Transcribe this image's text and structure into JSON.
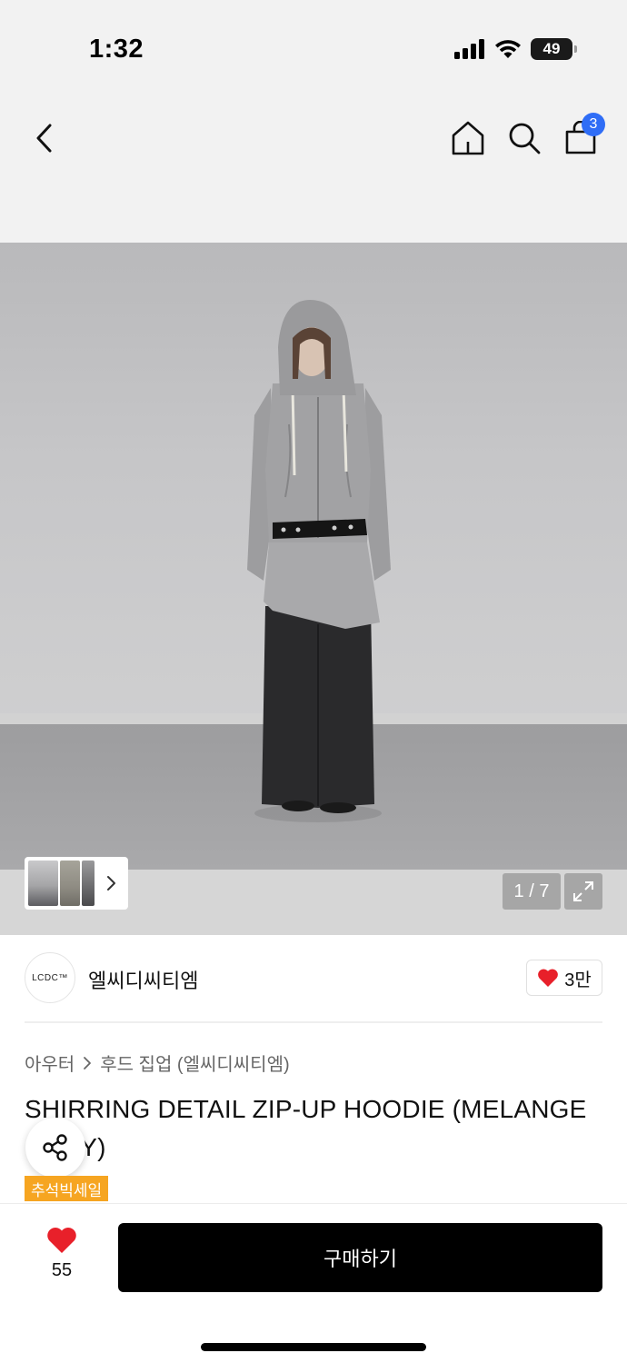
{
  "status_bar": {
    "time": "1:32",
    "battery": "49"
  },
  "nav": {
    "cart_count": "3"
  },
  "gallery": {
    "counter": "1 / 7"
  },
  "brand": {
    "logo_text": "LCDC™",
    "name": "엘씨디씨티엠",
    "likes": "3만"
  },
  "breadcrumb": {
    "category": "아우터",
    "subcategory": "후드 집업 (엘씨디씨티엠)"
  },
  "product": {
    "title": "SHIRRING DETAIL ZIP-UP HOODIE (MELANGE GREY)",
    "badge": "추석빅세일"
  },
  "bottom": {
    "wish_count": "55",
    "buy_label": "구매하기"
  },
  "colors": {
    "accent_blue": "#2f6df6",
    "heart_red": "#e8202a",
    "badge_orange": "#f6a521"
  }
}
